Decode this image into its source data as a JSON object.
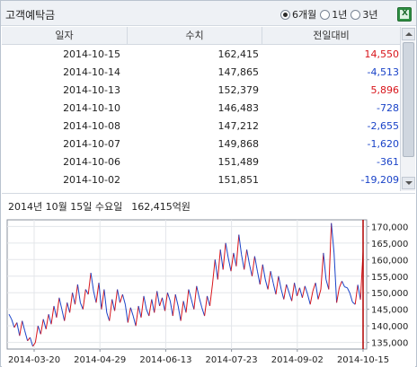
{
  "header": {
    "title": "고객예탁금",
    "period_options": [
      {
        "label": "6개월",
        "selected": true
      },
      {
        "label": "1년",
        "selected": false
      },
      {
        "label": "3년",
        "selected": false
      }
    ],
    "export_icon": "excel-icon"
  },
  "table": {
    "columns": [
      "일자",
      "수치",
      "전일대비"
    ],
    "rows": [
      {
        "date": "2014-10-15",
        "value": "162,415",
        "change": "14,550",
        "dir": "up"
      },
      {
        "date": "2014-10-14",
        "value": "147,865",
        "change": "-4,513",
        "dir": "down"
      },
      {
        "date": "2014-10-13",
        "value": "152,379",
        "change": "5,896",
        "dir": "up"
      },
      {
        "date": "2014-10-10",
        "value": "146,483",
        "change": "-728",
        "dir": "down"
      },
      {
        "date": "2014-10-08",
        "value": "147,212",
        "change": "-2,655",
        "dir": "down"
      },
      {
        "date": "2014-10-07",
        "value": "149,868",
        "change": "-1,620",
        "dir": "down"
      },
      {
        "date": "2014-10-06",
        "value": "151,489",
        "change": "-361",
        "dir": "down"
      },
      {
        "date": "2014-10-02",
        "value": "151,851",
        "change": "-19,209",
        "dir": "down"
      }
    ]
  },
  "info": {
    "date_text": "2014년 10월 15일 수요일",
    "value_text": "162,415억원"
  },
  "colors": {
    "up": "#d8141a",
    "down": "#1a43c8",
    "cursor": "#b00000"
  },
  "chart_data": {
    "type": "line",
    "x_tick_labels": [
      "2014-03-20",
      "2014-04-29",
      "2014-06-13",
      "2014-07-23",
      "2014-09-02",
      "2014-10-15"
    ],
    "y_tick_labels": [
      "135,000",
      "140,000",
      "145,000",
      "150,000",
      "155,000",
      "160,000",
      "165,000",
      "170,000"
    ],
    "ylim": [
      133000,
      172000
    ],
    "grid": true,
    "cursor_at": "2014-10-15",
    "series": [
      {
        "values": [
          143500,
          142000,
          139500,
          141000,
          137000,
          141500,
          138500,
          135500,
          136500,
          133800,
          135000,
          140000,
          137500,
          142000,
          139000,
          143500,
          140500,
          146000,
          142500,
          148500,
          145000,
          141500,
          147000,
          144000,
          150000,
          146500,
          152500,
          147000,
          145000,
          151000,
          149500,
          156000,
          150500,
          147000,
          153000,
          145000,
          151000,
          144000,
          141500,
          148000,
          144500,
          151000,
          147000,
          149500,
          146500,
          141000,
          145500,
          143000,
          140000,
          146000,
          142500,
          149000,
          145000,
          143000,
          148000,
          144000,
          150500,
          146000,
          148500,
          144500,
          150000,
          147500,
          143000,
          149500,
          146000,
          141500,
          147500,
          144000,
          151000,
          148000,
          145000,
          152000,
          148500,
          145500,
          143000,
          149000,
          146000,
          152500,
          160000,
          154000,
          163000,
          157000,
          165000,
          160500,
          156500,
          162000,
          158000,
          167500,
          161500,
          157000,
          163000,
          158500,
          155000,
          161000,
          156500,
          152500,
          158500,
          154000,
          151000,
          156500,
          153000,
          149500,
          155000,
          151000,
          148000,
          152500,
          150000,
          147500,
          153000,
          149000,
          151500,
          148500,
          152000,
          149500,
          146500,
          150500,
          153000,
          148000,
          151000,
          162000,
          154000,
          151000,
          171000,
          162000,
          147000,
          151500,
          153500,
          151800,
          151500,
          149900,
          147200,
          146500,
          152400,
          147900,
          162400
        ]
      }
    ]
  }
}
